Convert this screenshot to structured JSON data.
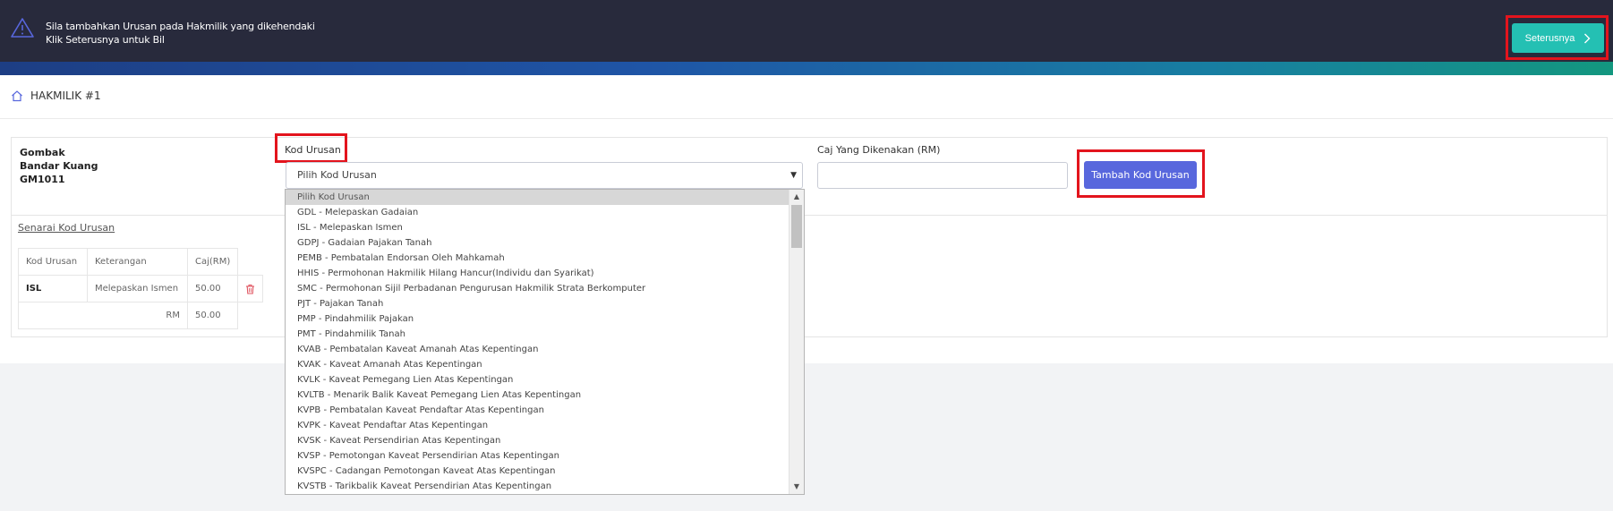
{
  "topbar": {
    "message_line1": "Sila tambahkan Urusan pada Hakmilik yang dikehendaki",
    "message_line2": "Klik Seterusnya untuk Bil",
    "warning_icon": "warning-triangle-icon",
    "next_label": "Seterusnya",
    "next_icon": "chevron-right-icon",
    "accent_color": "#24c0b3",
    "highlight_color": "#e3141d"
  },
  "page": {
    "title": "HAKMILIK #1",
    "title_icon": "home-icon"
  },
  "location": {
    "district": "Gombak",
    "area": "Bandar Kuang",
    "title_no": "GM1011"
  },
  "form": {
    "kod_label": "Kod Urusan",
    "select_value": "Pilih Kod Urusan",
    "caj_label": "Caj Yang Dikenakan (RM)",
    "caj_value": "",
    "add_button": "Tambah Kod Urusan",
    "add_button_color": "#5867dd"
  },
  "senarai": {
    "label": "Senarai Kod Urusan",
    "headers": [
      "Kod Urusan",
      "Keterangan",
      "Caj(RM)"
    ],
    "rows": [
      {
        "kod": "ISL",
        "keterangan": "Melepaskan Ismen",
        "caj": "50.00"
      }
    ],
    "total_label": "RM",
    "total_value": "50.00",
    "delete_icon": "trash-icon"
  },
  "dropdown": {
    "options": [
      "Pilih Kod Urusan",
      "GDL - Melepaskan Gadaian",
      "ISL - Melepaskan Ismen",
      "GDPJ - Gadaian Pajakan Tanah",
      "PEMB - Pembatalan Endorsan Oleh Mahkamah",
      "HHIS - Permohonan Hakmilik Hilang Hancur(Individu dan Syarikat)",
      "SMC - Permohonan Sijil Perbadanan Pengurusan Hakmilik Strata Berkomputer",
      "PJT - Pajakan Tanah",
      "PMP - Pindahmilik Pajakan",
      "PMT - Pindahmilik Tanah",
      "KVAB - Pembatalan Kaveat Amanah Atas Kepentingan",
      "KVAK - Kaveat Amanah Atas Kepentingan",
      "KVLK - Kaveat Pemegang Lien Atas Kepentingan",
      "KVLTB - Menarik Balik Kaveat Pemegang Lien Atas Kepentingan",
      "KVPB - Pembatalan Kaveat Pendaftar Atas Kepentingan",
      "KVPK - Kaveat Pendaftar Atas Kepentingan",
      "KVSK - Kaveat Persendirian Atas Kepentingan",
      "KVSP - Pemotongan Kaveat Persendirian Atas Kepentingan",
      "KVSPC - Cadangan Pemotongan Kaveat Atas Kepentingan",
      "KVSTB - Tarikbalik Kaveat Persendirian Atas Kepentingan"
    ],
    "selected_index": 0,
    "scroll_up_icon": "scroll-up-arrow-icon",
    "scroll_down_icon": "scroll-down-arrow-icon"
  }
}
